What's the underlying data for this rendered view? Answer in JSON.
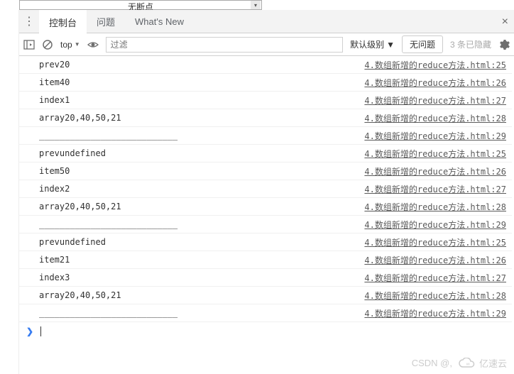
{
  "topDropdown": {
    "label": "无断点"
  },
  "tabs": {
    "items": [
      {
        "label": "控制台",
        "active": true
      },
      {
        "label": "问题",
        "active": false
      },
      {
        "label": "What's New",
        "active": false
      }
    ]
  },
  "toolbar": {
    "context": "top",
    "filterPlaceholder": "过滤",
    "levelLabel": "默认级别",
    "noIssues": "无问题",
    "hiddenCount": "3 条已隐藏"
  },
  "sourceFile": "4.数组新增的reduce方法.html",
  "logs": [
    {
      "msg": "prev20",
      "line": 25
    },
    {
      "msg": "item40",
      "line": 26
    },
    {
      "msg": "index1",
      "line": 27
    },
    {
      "msg": "array20,40,50,21",
      "line": 28
    },
    {
      "msg": "___________________________",
      "line": 29
    },
    {
      "msg": "prevundefined",
      "line": 25
    },
    {
      "msg": "item50",
      "line": 26
    },
    {
      "msg": "index2",
      "line": 27
    },
    {
      "msg": "array20,40,50,21",
      "line": 28
    },
    {
      "msg": "___________________________",
      "line": 29
    },
    {
      "msg": "prevundefined",
      "line": 25
    },
    {
      "msg": "item21",
      "line": 26
    },
    {
      "msg": "index3",
      "line": 27
    },
    {
      "msg": "array20,40,50,21",
      "line": 28
    },
    {
      "msg": "___________________________",
      "line": 29
    }
  ],
  "watermark": {
    "csdn": "CSDN @,",
    "brand": "亿速云"
  }
}
